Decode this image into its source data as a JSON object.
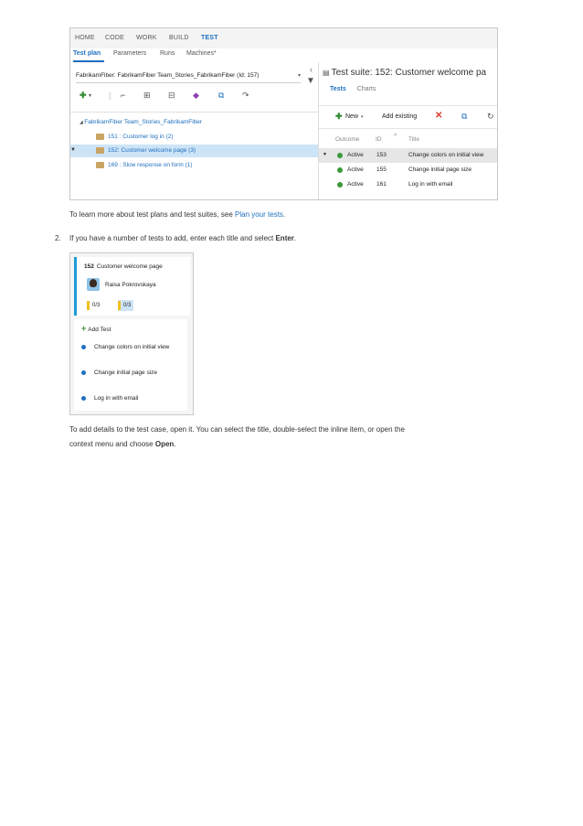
{
  "screenshot1": {
    "nav": [
      "HOME",
      "CODE",
      "WORK",
      "BUILD",
      "TEST"
    ],
    "subnav": [
      "Test plan",
      "Parameters",
      "Runs",
      "Machines*"
    ],
    "plan_select": "FabrikamFiber: FabrikamFiber Team_Stories_FabrikamFiber (Id: 157)",
    "tree": {
      "root": "FabrikamFiber Team_Stories_FabrikamFiber",
      "items": [
        "151 : Customer log in (2)",
        "152: Customer welcome page (3)",
        "169 : Slow response on form (1)"
      ]
    },
    "suite_title": "Test suite: 152: Customer welcome pa",
    "tabs": [
      "Tests",
      "Charts"
    ],
    "toolbar": {
      "new": "New",
      "add_existing": "Add existing"
    },
    "headers": {
      "outcome": "Outcome",
      "id": "ID",
      "title": "Title"
    },
    "rows": [
      {
        "outcome": "Active",
        "id": "153",
        "title": "Change colors on initial view"
      },
      {
        "outcome": "Active",
        "id": "155",
        "title": "Change initial page size"
      },
      {
        "outcome": "Active",
        "id": "161",
        "title": "Log in with email"
      }
    ],
    "colors": {
      "accent": "#1e6fbf",
      "selected": "#cde4f7",
      "active_dot": "#3a9a3a"
    }
  },
  "text": {
    "learn_prefix": "To learn more about test plans and test suites, see ",
    "learn_link": "Plan your tests",
    "learn_suffix": ".",
    "step_number": "2.",
    "step_prefix": "If you have a number of tests to add, enter each title and select ",
    "step_bold": "Enter",
    "step_suffix": ".",
    "details_line1": "To add details to the test case, open it. You can select the title, double-select the inline item, or open the",
    "details_line2_prefix": "context menu and choose ",
    "details_bold": "Open",
    "details_suffix": "."
  },
  "screenshot2": {
    "card_id": "152",
    "card_title": "Customer welcome page",
    "owner": "Raisa Pokrovskaya",
    "badges": [
      "0/3",
      "0/3"
    ],
    "add_test": "Add Test",
    "items": [
      "Change colors on initial view",
      "Change initial page size",
      "Log in with email"
    ]
  }
}
